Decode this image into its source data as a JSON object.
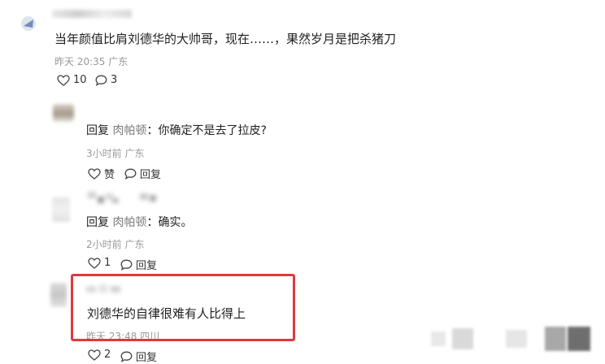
{
  "comment": {
    "text": "当年颜值比肩刘德华的大帅哥，现在……，果然岁月是把杀猪刀",
    "meta": "昨天 20:35 广东",
    "like_count": "10",
    "reply_count": "3"
  },
  "replies": [
    {
      "prefix": "回复",
      "target": "肉帕顿",
      "text": "：你确定不是去了拉皮?",
      "meta": "3小时前 广东",
      "like_label": "赞",
      "reply_label": "回复"
    },
    {
      "prefix": "回复",
      "target": "肉帕顿",
      "text": "：确实。",
      "meta": "2小时前 广东",
      "like_label": "1",
      "reply_label": "回复"
    },
    {
      "text": "刘德华的自律很难有人比得上",
      "meta": "昨天 23:48 四川",
      "like_label": "2",
      "reply_label": "回复"
    }
  ],
  "colors": {
    "highlight": "#e0393e",
    "meta": "#999999",
    "text": "#1f1f1f"
  }
}
